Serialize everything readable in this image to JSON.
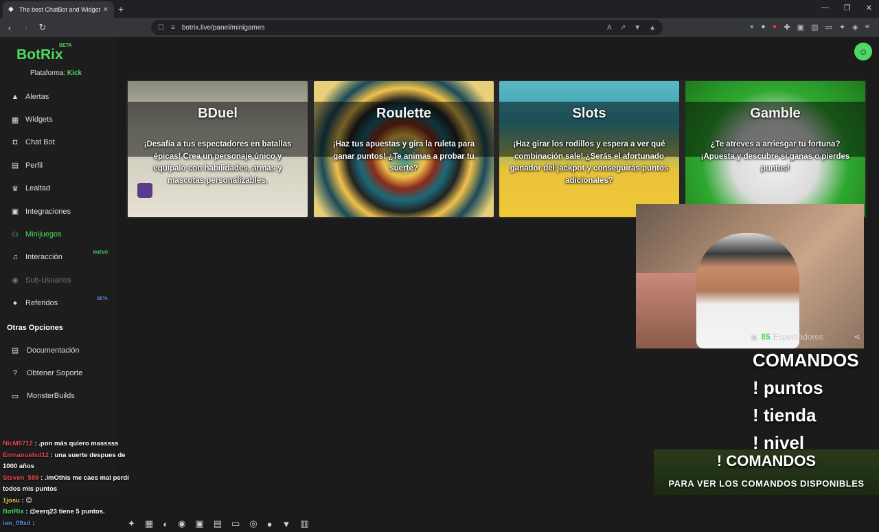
{
  "browser": {
    "tab_title": "The best ChatBot and Widgets f...",
    "tab_close": "✕",
    "new_tab": "+",
    "url": "botrix.live/panel/minigames",
    "win_min": "—",
    "win_restore": "❐",
    "win_close": "✕"
  },
  "app": {
    "logo": "BotRix",
    "logo_badge": "BETA",
    "platform_label": "Plataforma:",
    "platform_value": "Kick"
  },
  "sidebar": {
    "items": [
      {
        "label": "Alertas",
        "icon": "warning-icon"
      },
      {
        "label": "Widgets",
        "icon": "grid-icon"
      },
      {
        "label": "Chat Bot",
        "icon": "robot-icon"
      },
      {
        "label": "Perfil",
        "icon": "id-card-icon"
      },
      {
        "label": "Lealtad",
        "icon": "trophy-icon"
      },
      {
        "label": "Integraciones",
        "icon": "plug-icon"
      },
      {
        "label": "Minijuegos",
        "icon": "gamepad-icon"
      },
      {
        "label": "Interacción",
        "icon": "music-icon",
        "badge": "NUEVO"
      },
      {
        "label": "Sub-Usuarios",
        "icon": "users-icon"
      },
      {
        "label": "Referidos",
        "icon": "referral-icon",
        "badge": "BETA"
      }
    ],
    "section_title": "Otras Opciones",
    "sub_items": [
      {
        "label": "Documentación",
        "icon": "book-icon"
      },
      {
        "label": "Obtener Soporte",
        "icon": "help-icon"
      },
      {
        "label": "MonsterBuilds",
        "icon": "monitor-icon"
      }
    ]
  },
  "games": [
    {
      "title": "BDuel",
      "desc": "¡Desafía a tus espectadores en batallas épicas! Crea un personaje único y equípalo con habilidades, armas y mascotas personalizables."
    },
    {
      "title": "Roulette",
      "desc": "¡Haz tus apuestas y gira la ruleta para ganar puntos! ¿Te animas a probar tu suerte?"
    },
    {
      "title": "Slots",
      "desc": "¡Haz girar los rodillos y espera a ver qué combinación sale! ¿Serás el afortunado ganador del jackpot y conseguirás puntos adicionales?"
    },
    {
      "title": "Gamble",
      "desc": "¿Te atreves a arriesgar tu fortuna? ¡Apuesta y descubre si ganas o pierdes puntos!"
    }
  ],
  "stream": {
    "viewers_count": "85",
    "viewers_label": "Espectadores",
    "commands_title": "COMANDOS",
    "commands": [
      "! puntos",
      "! tienda",
      "! nivel"
    ],
    "banner_title": "! COMANDOS",
    "banner_sub": "PARA VER LOS COMANDOS DISPONIBLES"
  },
  "chat": [
    {
      "user": "NicM0712",
      "text": ": .pon más quiero masssss",
      "color": "red"
    },
    {
      "user": "Enmanuelxd12",
      "text": ": una suerte despues de 1000 años",
      "color": "red"
    },
    {
      "user": "Steven_589",
      "text": ": .lmOthis me caes mal perdí todos mis puntos",
      "color": "red"
    },
    {
      "user": "1josu",
      "text": ": 😊",
      "color": "yellow"
    },
    {
      "user": "BotRix",
      "text": ": @eerq23 tiene 5 puntos.",
      "color": "green"
    },
    {
      "user": "ian_09xd",
      "text": ":",
      "color": "blue"
    }
  ]
}
